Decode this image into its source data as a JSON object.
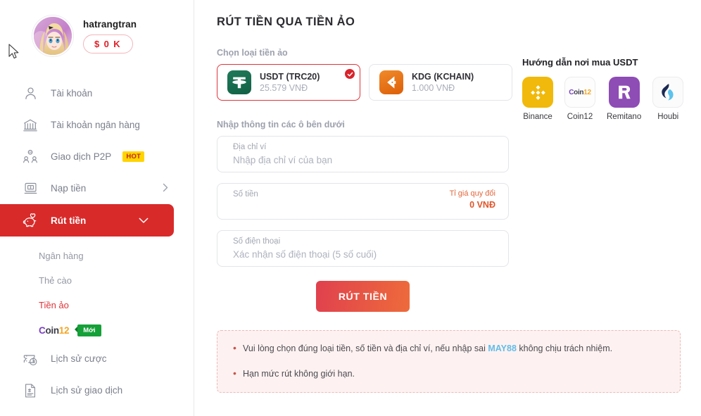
{
  "profile": {
    "username": "hatrangtran",
    "balance": "$ 0 K",
    "avatar_icon": "user-avatar-anime"
  },
  "sidebar": {
    "items": [
      {
        "label": "Tài khoản",
        "icon": "person-icon",
        "active": false,
        "chevron": false
      },
      {
        "label": "Tài khoản ngân hàng",
        "icon": "bank-icon",
        "active": false,
        "chevron": false
      },
      {
        "label": "Giao dịch P2P",
        "icon": "p2p-people-icon",
        "active": false,
        "chevron": false,
        "badge": "HOT"
      },
      {
        "label": "Nạp tiền",
        "icon": "atm-deposit-icon",
        "active": false,
        "chevron": true
      },
      {
        "label": "Rút tiền",
        "icon": "piggy-bank-heart-icon",
        "active": true,
        "chevron": true
      },
      {
        "label": "Lịch sử cược",
        "icon": "ticket-clock-icon",
        "active": false,
        "chevron": false
      },
      {
        "label": "Lịch sử giao dịch",
        "icon": "document-dollar-icon",
        "active": false,
        "chevron": false
      }
    ],
    "submenu": [
      {
        "label": "Ngân hàng",
        "active": false
      },
      {
        "label": "Thẻ cào",
        "active": false
      },
      {
        "label": "Tiền ảo",
        "active": true
      }
    ],
    "coin12": {
      "part1": "C",
      "part2": "oin",
      "part3": "12",
      "badge": "Mới"
    }
  },
  "main": {
    "page_title": "RÚT TIỀN QUA TIỀN ẢO",
    "coin_section_label": "Chọn loại tiền ảo",
    "form_section_label": "Nhập thông tin các ô bên dưới",
    "coins": [
      {
        "name": "USDT (TRC20)",
        "rate": "25.579 VNĐ",
        "icon": "tether-icon",
        "selected": true
      },
      {
        "name": "KDG (KCHAIN)",
        "rate": "1.000 VNĐ",
        "icon": "kdg-arrow-icon",
        "selected": false
      }
    ],
    "fields": [
      {
        "label": "Địa chỉ ví",
        "placeholder": "Nhập địa chỉ ví của bạn",
        "value": ""
      },
      {
        "label": "Số tiền",
        "placeholder": "",
        "value": "",
        "rate_label": "Tỉ giá quy đổi",
        "rate_value": "0 VNĐ"
      },
      {
        "label": "Số điện thoại",
        "placeholder": "Xác nhận số điện thoại  (5 số cuối)",
        "value": ""
      }
    ],
    "submit_label": "RÚT TIỀN",
    "notice": [
      {
        "before": "Vui lòng chọn đúng loại tiền, số tiền và địa chỉ ví, nếu nhập sai ",
        "link": "MAY88",
        "after": " không chịu trách nhiệm."
      },
      {
        "before": "Hạn mức rút không giới hạn.",
        "link": "",
        "after": ""
      }
    ]
  },
  "guide": {
    "title": "Hướng dẫn nơi mua USDT",
    "exchanges": [
      {
        "name": "Binance",
        "icon": "binance-logo"
      },
      {
        "name": "Coin12",
        "icon": "coin12-logo"
      },
      {
        "name": "Remitano",
        "icon": "remitano-logo"
      },
      {
        "name": "Houbi",
        "icon": "huobi-logo"
      }
    ]
  },
  "colors": {
    "brand_red": "#d92a2a",
    "active_red": "#e0343a",
    "accent_orange": "#e0562a",
    "link_blue": "#63bce8",
    "hot_yellow": "#ffd400",
    "new_green": "#15a038",
    "binance_yellow": "#f0b90b",
    "remitano_purple": "#8e4cb5",
    "usdt_green": "#1f7a5a",
    "kdg_orange": "#e5701a"
  }
}
